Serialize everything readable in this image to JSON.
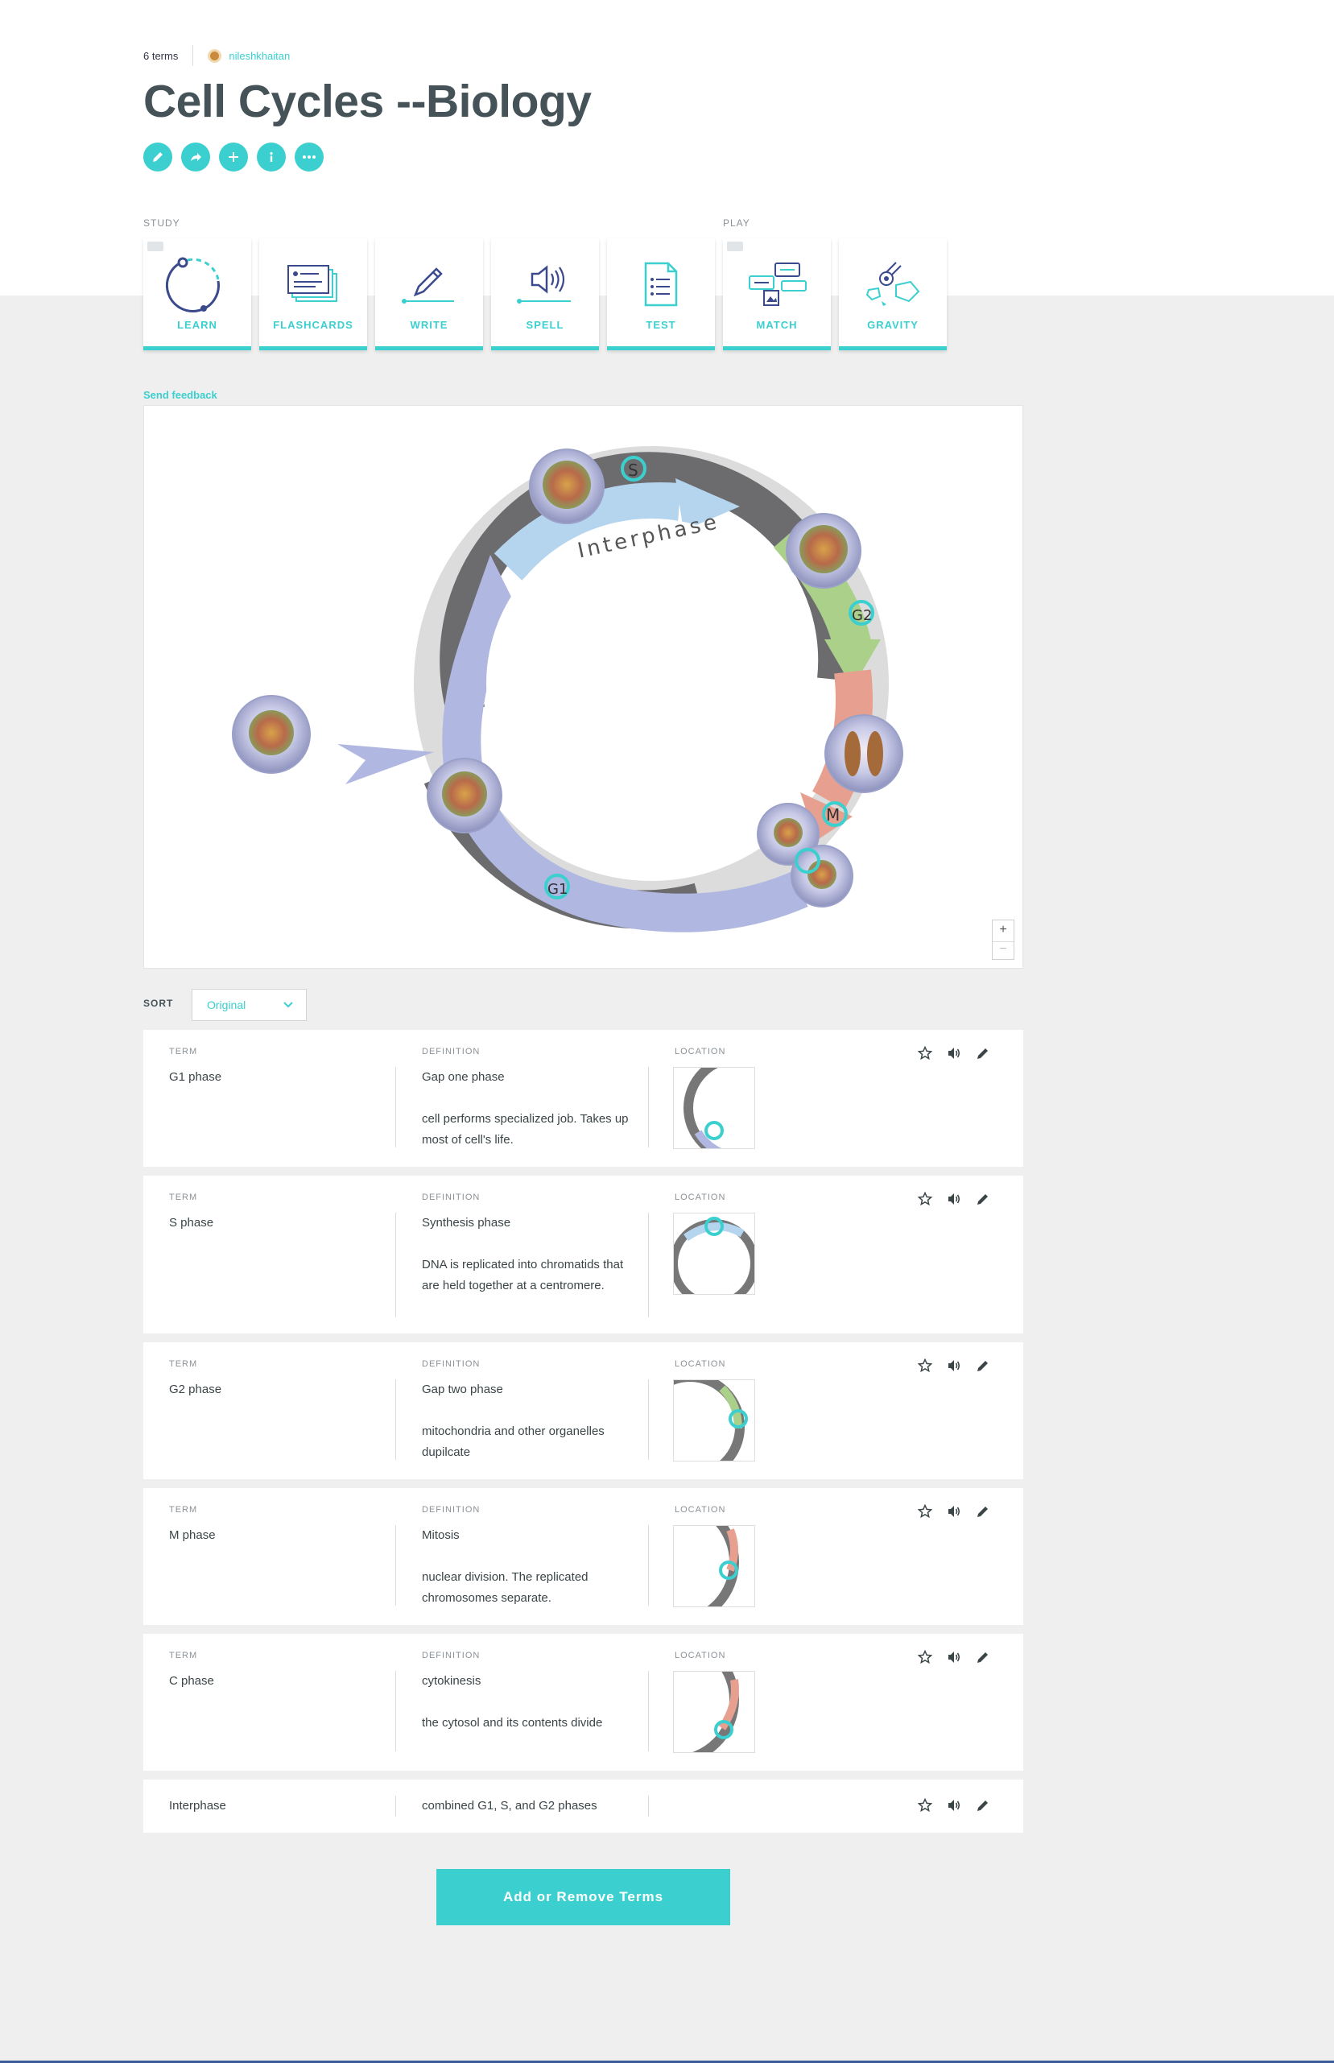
{
  "header": {
    "term_count": "6 terms",
    "username": "nileshkhaitan",
    "title": "Cell Cycles --Biology"
  },
  "action_icons": [
    "pencil-icon",
    "share-icon",
    "plus-icon",
    "info-icon",
    "more-icon"
  ],
  "study": {
    "label": "STUDY",
    "modes": [
      "LEARN",
      "FLASHCARDS",
      "WRITE",
      "SPELL",
      "TEST"
    ]
  },
  "play": {
    "label": "PLAY",
    "modes": [
      "MATCH",
      "GRAVITY"
    ]
  },
  "feedback_link": "Send feedback",
  "diagram": {
    "ring_label": "Interphase",
    "markers": [
      "S",
      "G2",
      "M",
      "G1"
    ],
    "zoom_in": "+",
    "zoom_out": "−"
  },
  "sort": {
    "label": "SORT",
    "selected": "Original"
  },
  "column_labels": {
    "term": "TERM",
    "definition": "DEFINITION",
    "location": "LOCATION"
  },
  "terms": [
    {
      "term": "G1 phase",
      "definition_title": "Gap one phase",
      "definition_body": "cell performs specialized job. Takes up most of cell's life."
    },
    {
      "term": "S phase",
      "definition_title": "Synthesis phase",
      "definition_body": "DNA is replicated into chromatids that are held together at a centromere."
    },
    {
      "term": "G2 phase",
      "definition_title": "Gap two phase",
      "definition_body": "mitochondria and other organelles dupilcate"
    },
    {
      "term": "M phase",
      "definition_title": "Mitosis",
      "definition_body": "nuclear division. The replicated chromosomes separate."
    },
    {
      "term": "C phase",
      "definition_title": "cytokinesis",
      "definition_body": "the cytosol and its contents divide"
    },
    {
      "term": "Interphase",
      "definition_title": "combined G1, S, and G2 phases",
      "definition_body": ""
    }
  ],
  "add_button": "Add or Remove Terms",
  "colors": {
    "accent": "#3ccfcf",
    "title": "#455358",
    "background": "#efefef"
  }
}
